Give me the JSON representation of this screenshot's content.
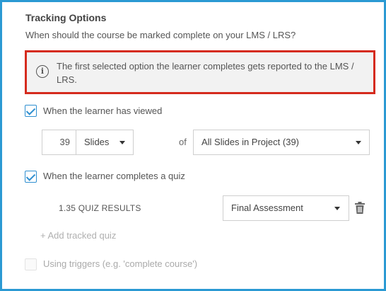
{
  "tracking": {
    "title": "Tracking Options",
    "question": "When should the course be marked complete on your LMS / LRS?",
    "info_icon": "info-icon",
    "info_text": "The first selected option the learner completes gets reported to the LMS / LRS."
  },
  "viewed": {
    "label": "When the learner has viewed",
    "checked": true,
    "count": "39",
    "unit": "Slides",
    "of_label": "of",
    "scope": "All Slides in Project (39)"
  },
  "quiz": {
    "label": "When the learner completes a quiz",
    "checked": true,
    "tracked": [
      {
        "name": "1.35 QUIZ RESULTS",
        "selection": "Final Assessment",
        "delete_icon": "trash-icon"
      }
    ],
    "add_label": "+ Add tracked quiz"
  },
  "triggers": {
    "label": "Using triggers (e.g. 'complete course')",
    "checked": false,
    "disabled": true
  },
  "colors": {
    "frame": "#2b9ad3",
    "highlight": "#d52b1e",
    "checkbox": "#2f8fd0"
  }
}
